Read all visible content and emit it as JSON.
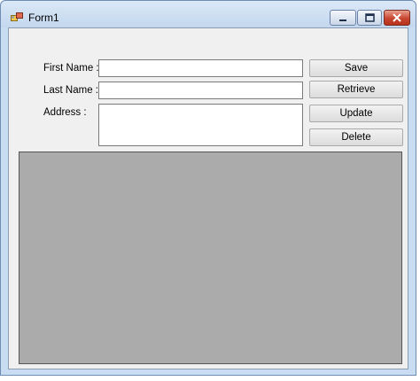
{
  "window": {
    "title": "Form1",
    "icon": "windows-form-app-icon",
    "controls": {
      "minimize_icon": "minimize-icon",
      "maximize_icon": "maximize-icon",
      "close_icon": "close-icon"
    }
  },
  "form": {
    "first_name": {
      "label": "First Name :",
      "value": ""
    },
    "last_name": {
      "label": "Last Name :",
      "value": ""
    },
    "address": {
      "label": "Address :",
      "value": ""
    }
  },
  "buttons": {
    "save": "Save",
    "retrieve": "Retrieve",
    "update": "Update",
    "delete": "Delete"
  },
  "colors": {
    "titlebar": "#c3d7ee",
    "client_background": "#f0f0f0",
    "grid_background": "#ababab",
    "close_button": "#c8452f"
  }
}
